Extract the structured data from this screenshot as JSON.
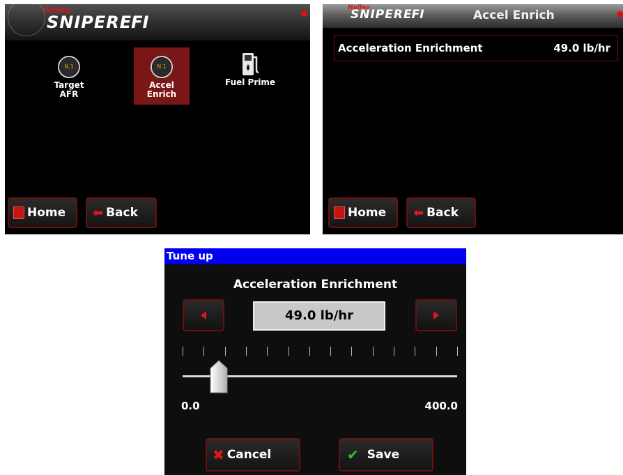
{
  "menu_screen": {
    "brand": {
      "maker": "Holley",
      "logo_main": "SNIPER",
      "logo_efi": "EFI"
    },
    "items": [
      {
        "label_line1": "Target",
        "label_line2": "AFR",
        "icon": "gauge-icon",
        "gauge_text": "N.1",
        "selected": false
      },
      {
        "label_line1": "Accel",
        "label_line2": "Enrich",
        "icon": "gauge-icon",
        "gauge_text": "N.1",
        "selected": true
      },
      {
        "label_line1": "Fuel Prime",
        "label_line2": "",
        "icon": "fuel-pump-icon",
        "selected": false
      }
    ],
    "buttons": {
      "home_label": "Home",
      "back_label": "Back"
    }
  },
  "detail_screen": {
    "brand": {
      "maker": "Holley",
      "logo_main": "SNIPER",
      "logo_efi": "EFI"
    },
    "title": "Accel Enrich",
    "field": {
      "label": "Acceleration Enrichment",
      "value": "49.0 lb/hr"
    },
    "buttons": {
      "home_label": "Home",
      "back_label": "Back"
    }
  },
  "tune_dialog": {
    "window_title": "Tune up",
    "heading": "Acceleration Enrichment",
    "value": "49.0 lb/hr",
    "slider": {
      "min_label": "0.0",
      "max_label": "400.0",
      "min": 0,
      "max": 400,
      "value": 49
    },
    "buttons": {
      "cancel_label": "Cancel",
      "save_label": "Save"
    }
  },
  "colors": {
    "accent_red": "#e01818",
    "title_blue": "#0000ee",
    "selected_bg": "#7a1616",
    "save_check": "#2fc02f"
  }
}
